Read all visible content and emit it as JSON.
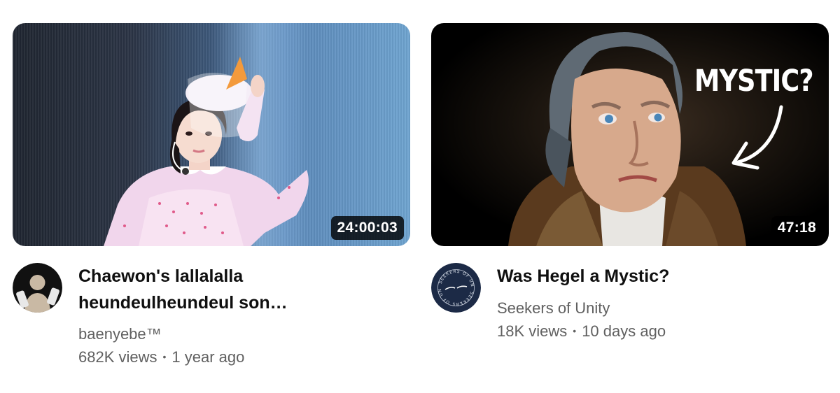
{
  "videos": [
    {
      "duration": "24:00:03",
      "title_line1": "Chaewon's lallalalla",
      "title_line2": "heundeulheundeul son…",
      "channel": "baenyebe™",
      "views": "682K views",
      "age": "1 year ago"
    },
    {
      "duration": "47:18",
      "thumbnail_text": "MYSTIC?",
      "title": "Was Hegel a Mystic?",
      "channel": "Seekers of Unity",
      "avatar_text": "SEEKERS OF UNITY",
      "views": "18K views",
      "age": "10 days ago"
    }
  ],
  "separator": "•",
  "colors": {
    "text": "#0f0f0f",
    "secondary": "#606060",
    "duration_bg": "#000000cc"
  }
}
